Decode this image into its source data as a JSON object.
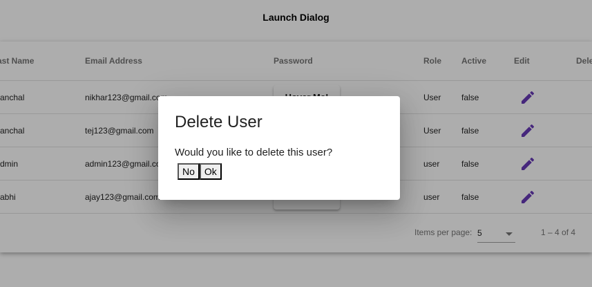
{
  "header": {
    "title": "Launch Dialog"
  },
  "table": {
    "columns": [
      "ast Name",
      "Email Address",
      "Password",
      "Role",
      "Active",
      "Edit",
      "Dele"
    ],
    "rows": [
      {
        "last_name": "anchal",
        "email": "nikhar123@gmail.com",
        "password_button": "Hover Me!",
        "role": "User",
        "active": "false"
      },
      {
        "last_name": "anchal",
        "email": "tej123@gmail.com",
        "password_button": "",
        "role": "User",
        "active": "false"
      },
      {
        "last_name": "dmin",
        "email": "admin123@gmail.com",
        "password_button": "",
        "role": "user",
        "active": "false"
      },
      {
        "last_name": "abhi",
        "email": "ajay123@gmail.com",
        "password_button": "",
        "role": "user",
        "active": "false"
      }
    ]
  },
  "paginator": {
    "items_per_page_label": "Items per page:",
    "page_size": "5",
    "range_label": "1 – 4 of 4"
  },
  "dialog": {
    "title": "Delete User",
    "message": "Would you like to delete this user?",
    "no_label": "No",
    "ok_label": "Ok"
  },
  "colors": {
    "edit_icon": "#673ab7",
    "backdrop": "rgba(0,0,0,0.32)"
  }
}
